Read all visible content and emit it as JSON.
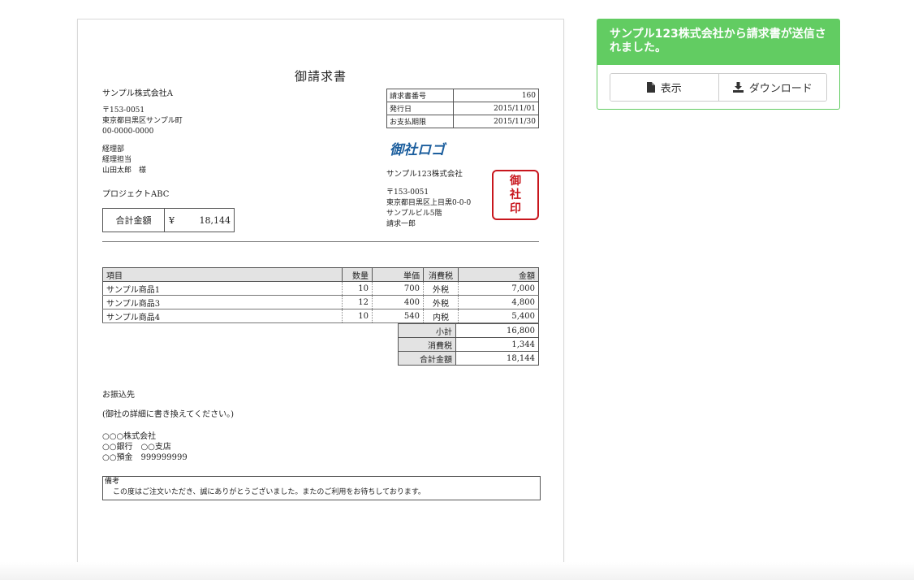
{
  "invoice": {
    "title": "御請求書",
    "recipient": {
      "company": "サンプル株式会社A",
      "postal": "〒153-0051",
      "address": "東京都目黒区サンプル町",
      "phone": "00-0000-0000",
      "dept": "経理部",
      "role": "経理担当",
      "person": "山田太郎　様"
    },
    "project": "プロジェクトABC",
    "total": {
      "label": "合計金額",
      "yen": "¥",
      "amount": "18,144"
    },
    "meta": [
      {
        "label": "請求書番号",
        "value": "160"
      },
      {
        "label": "発行日",
        "value": "2015/11/01"
      },
      {
        "label": "お支払期限",
        "value": "2015/11/30"
      }
    ],
    "issuer": {
      "logo": "御社ロゴ",
      "company": "サンプル123株式会社",
      "postal": "〒153-0051",
      "address": "東京都目黒区上目黒0-0-0",
      "building": "サンプルビル5階",
      "person": "請求一郎",
      "seal": [
        "御",
        "社",
        "印"
      ]
    },
    "items_header": {
      "name": "項目",
      "qty": "数量",
      "price": "単価",
      "tax": "消費税",
      "amount": "金額"
    },
    "items": [
      {
        "name": "サンプル商品1",
        "qty": "10",
        "price": "700",
        "tax": "外税",
        "amount": "7,000"
      },
      {
        "name": "サンプル商品3",
        "qty": "12",
        "price": "400",
        "tax": "外税",
        "amount": "4,800"
      },
      {
        "name": "サンプル商品4",
        "qty": "10",
        "price": "540",
        "tax": "内税",
        "amount": "5,400"
      }
    ],
    "summary": [
      {
        "label": "小計",
        "value": "16,800"
      },
      {
        "label": "消費税",
        "value": "1,344"
      },
      {
        "label": "合計金額",
        "value": "18,144"
      }
    ],
    "bank": {
      "heading": "お振込先",
      "note": "(御社の詳細に書き換えてください。)",
      "company": "○○○株式会社",
      "branch": "○○銀行　○○支店",
      "account": "○○預金　999999999"
    },
    "remarks": {
      "heading": "備考",
      "text": "この度はご注文いただき、誠にありがとうございました。またのご利用をお待ちしております。"
    }
  },
  "panel": {
    "message": "サンプル123株式会社から請求書が送信されました。",
    "view_label": "表示",
    "download_label": "ダウンロード"
  },
  "colors": {
    "panel_green": "#62cc62",
    "seal_red": "#c8161d",
    "logo_blue": "#1d5f9e"
  }
}
